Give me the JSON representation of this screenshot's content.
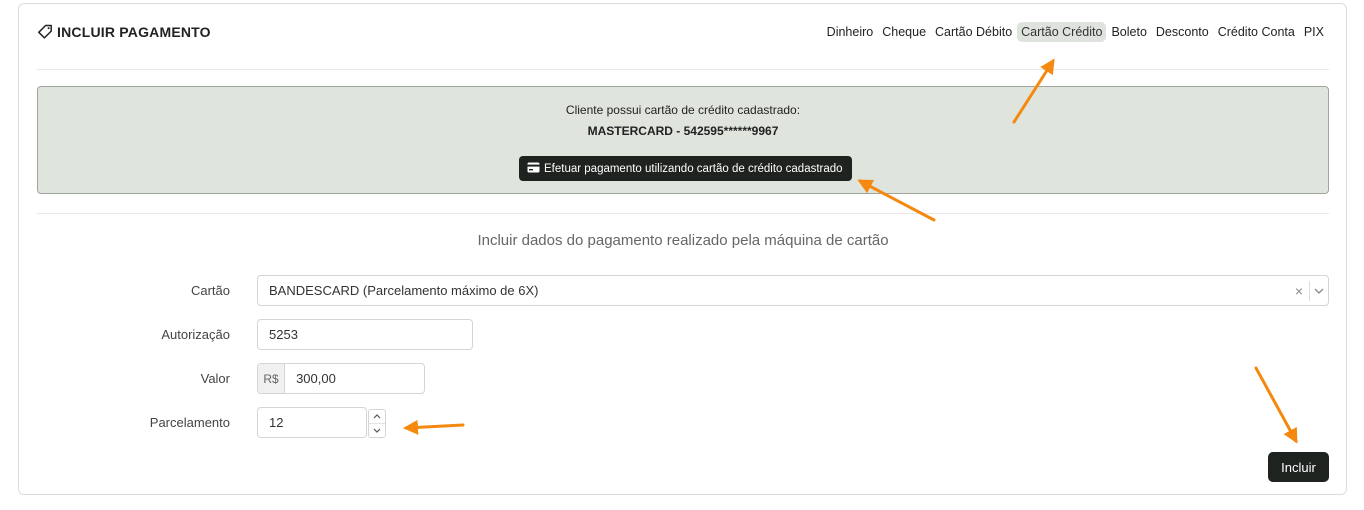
{
  "header": {
    "icon": "tag-icon",
    "title": "INCLUIR PAGAMENTO",
    "tabs": [
      {
        "label": "Dinheiro"
      },
      {
        "label": "Cheque"
      },
      {
        "label": "Cartão Débito"
      },
      {
        "label": "Cartão Crédito",
        "active": true
      },
      {
        "label": "Boleto"
      },
      {
        "label": "Desconto"
      },
      {
        "label": "Crédito Conta"
      },
      {
        "label": "PIX"
      }
    ]
  },
  "saved_card": {
    "message": "Cliente possui cartão de crédito cadastrado:",
    "card": "MASTERCARD - 542595******9967",
    "button_icon": "credit-card-icon",
    "button_label": "Efetuar pagamento utilizando cartão de crédito cadastrado"
  },
  "form": {
    "subtitle": "Incluir dados do pagamento realizado pela máquina de cartão",
    "cartao": {
      "label": "Cartão",
      "value": "BANDESCARD (Parcelamento máximo de 6X)",
      "clear": "×"
    },
    "autorizacao": {
      "label": "Autorização",
      "value": "5253"
    },
    "valor": {
      "label": "Valor",
      "currency": "R$",
      "value": "300,00"
    },
    "parcelamento": {
      "label": "Parcelamento",
      "value": "12"
    },
    "submit_label": "Incluir"
  },
  "colors": {
    "annotation_arrow": "#f5890f",
    "button_dark": "#1f2320",
    "info_bg": "#dfe4dd"
  }
}
